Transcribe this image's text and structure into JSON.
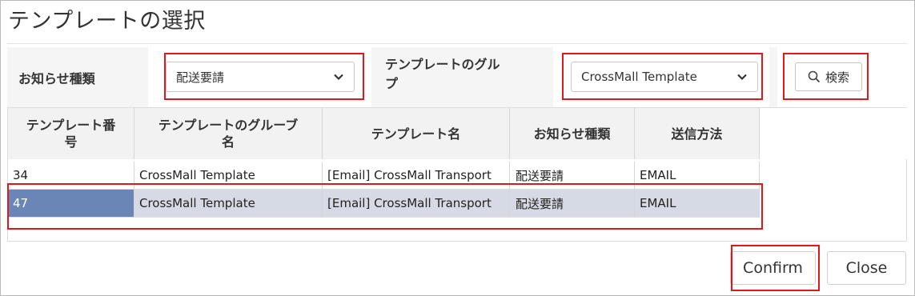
{
  "dialog": {
    "title": "テンプレートの選択"
  },
  "filters": {
    "notice_type_label": "お知らせ種類",
    "notice_type_value": "配送要請",
    "group_label": "テンプレートのグル\nプ",
    "group_value": "CrossMall Template",
    "search_label": "検索"
  },
  "table": {
    "headers": [
      "テンプレート番\n号",
      "テンプレートのグルーブ\n名",
      "テンプレート名",
      "お知らせ種類",
      "送信方法"
    ],
    "rows": [
      [
        "34",
        "CrossMall Template",
        "[Email] CrossMall Transport",
        "配送要請",
        "EMAIL"
      ],
      [
        "47",
        "CrossMall Template",
        "[Email] CrossMall Transport",
        "配送要請",
        "EMAIL"
      ]
    ],
    "selected_row": "47"
  },
  "footer": {
    "confirm_label": "Confirm",
    "close_label": "Close"
  },
  "colors": {
    "highlight": "#e0181b",
    "selected_row": "#d5dae4",
    "selected_cell": "#6a86b7"
  },
  "icons": {
    "select_arrow": "chevron-down-icon",
    "search": "search-icon"
  }
}
